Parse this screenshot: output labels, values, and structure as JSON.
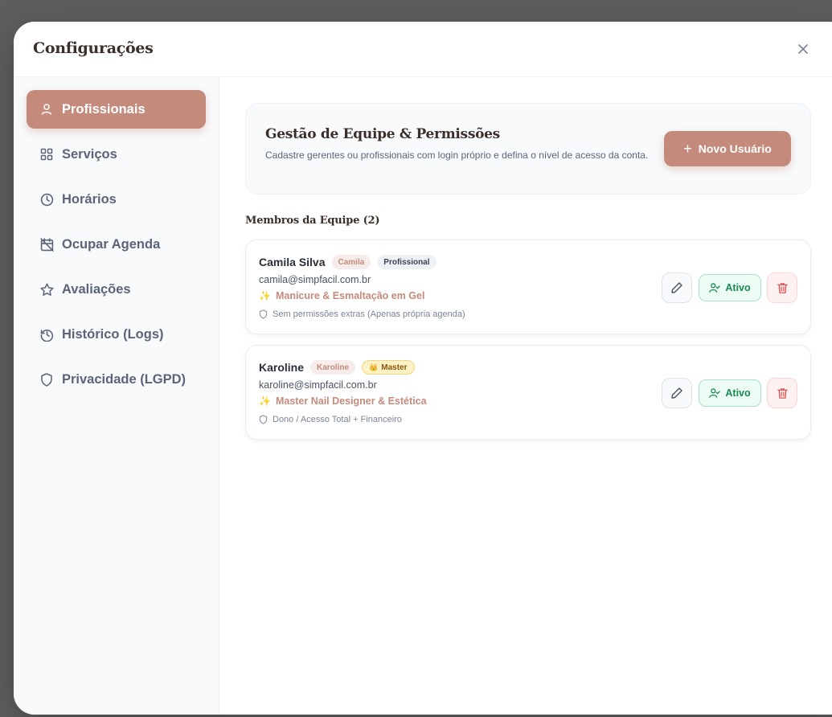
{
  "modal": {
    "title": "Configurações",
    "close_icon": "close-icon"
  },
  "sidebar": {
    "items": [
      {
        "id": "profissionais",
        "label": "Profissionais",
        "icon": "user-icon",
        "active": true
      },
      {
        "id": "servicos",
        "label": "Serviços",
        "icon": "grid-icon",
        "active": false
      },
      {
        "id": "horarios",
        "label": "Horários",
        "icon": "clock-icon",
        "active": false
      },
      {
        "id": "ocupar-agenda",
        "label": "Ocupar Agenda",
        "icon": "calendar-off-icon",
        "active": false
      },
      {
        "id": "avaliacoes",
        "label": "Avaliações",
        "icon": "star-icon",
        "active": false
      },
      {
        "id": "historico",
        "label": "Histórico (Logs)",
        "icon": "history-icon",
        "active": false
      },
      {
        "id": "privacidade",
        "label": "Privacidade (LGPD)",
        "icon": "shield-icon",
        "active": false
      }
    ]
  },
  "hero": {
    "title": "Gestão de Equipe & Permissões",
    "description": "Cadastre gerentes ou profissionais com login próprio e defina o nível de acesso da conta.",
    "new_user_label": "Novo Usuário"
  },
  "members_section": {
    "title": "Membros da Equipe (2)"
  },
  "members": [
    {
      "name": "Camila Silva",
      "nickname": "Camila",
      "role_badge": "Profissional",
      "email": "camila@simpfacil.com.br",
      "specialty": "Manicure & Esmaltação em Gel",
      "permissions": "Sem permissões extras (Apenas própria agenda)",
      "status_label": "Ativo"
    },
    {
      "name": "Karoline",
      "nickname": "Karoline",
      "role_badge": "Master",
      "email": "karoline@simpfacil.com.br",
      "specialty": "Master Nail Designer & Estética",
      "permissions": "Dono / Acesso Total + Financeiro",
      "status_label": "Ativo"
    }
  ],
  "colors": {
    "accent": "#c48b7c",
    "active_green": "#1a8a55",
    "danger_red": "#e05252",
    "master_gold": "#fdf1c7"
  }
}
